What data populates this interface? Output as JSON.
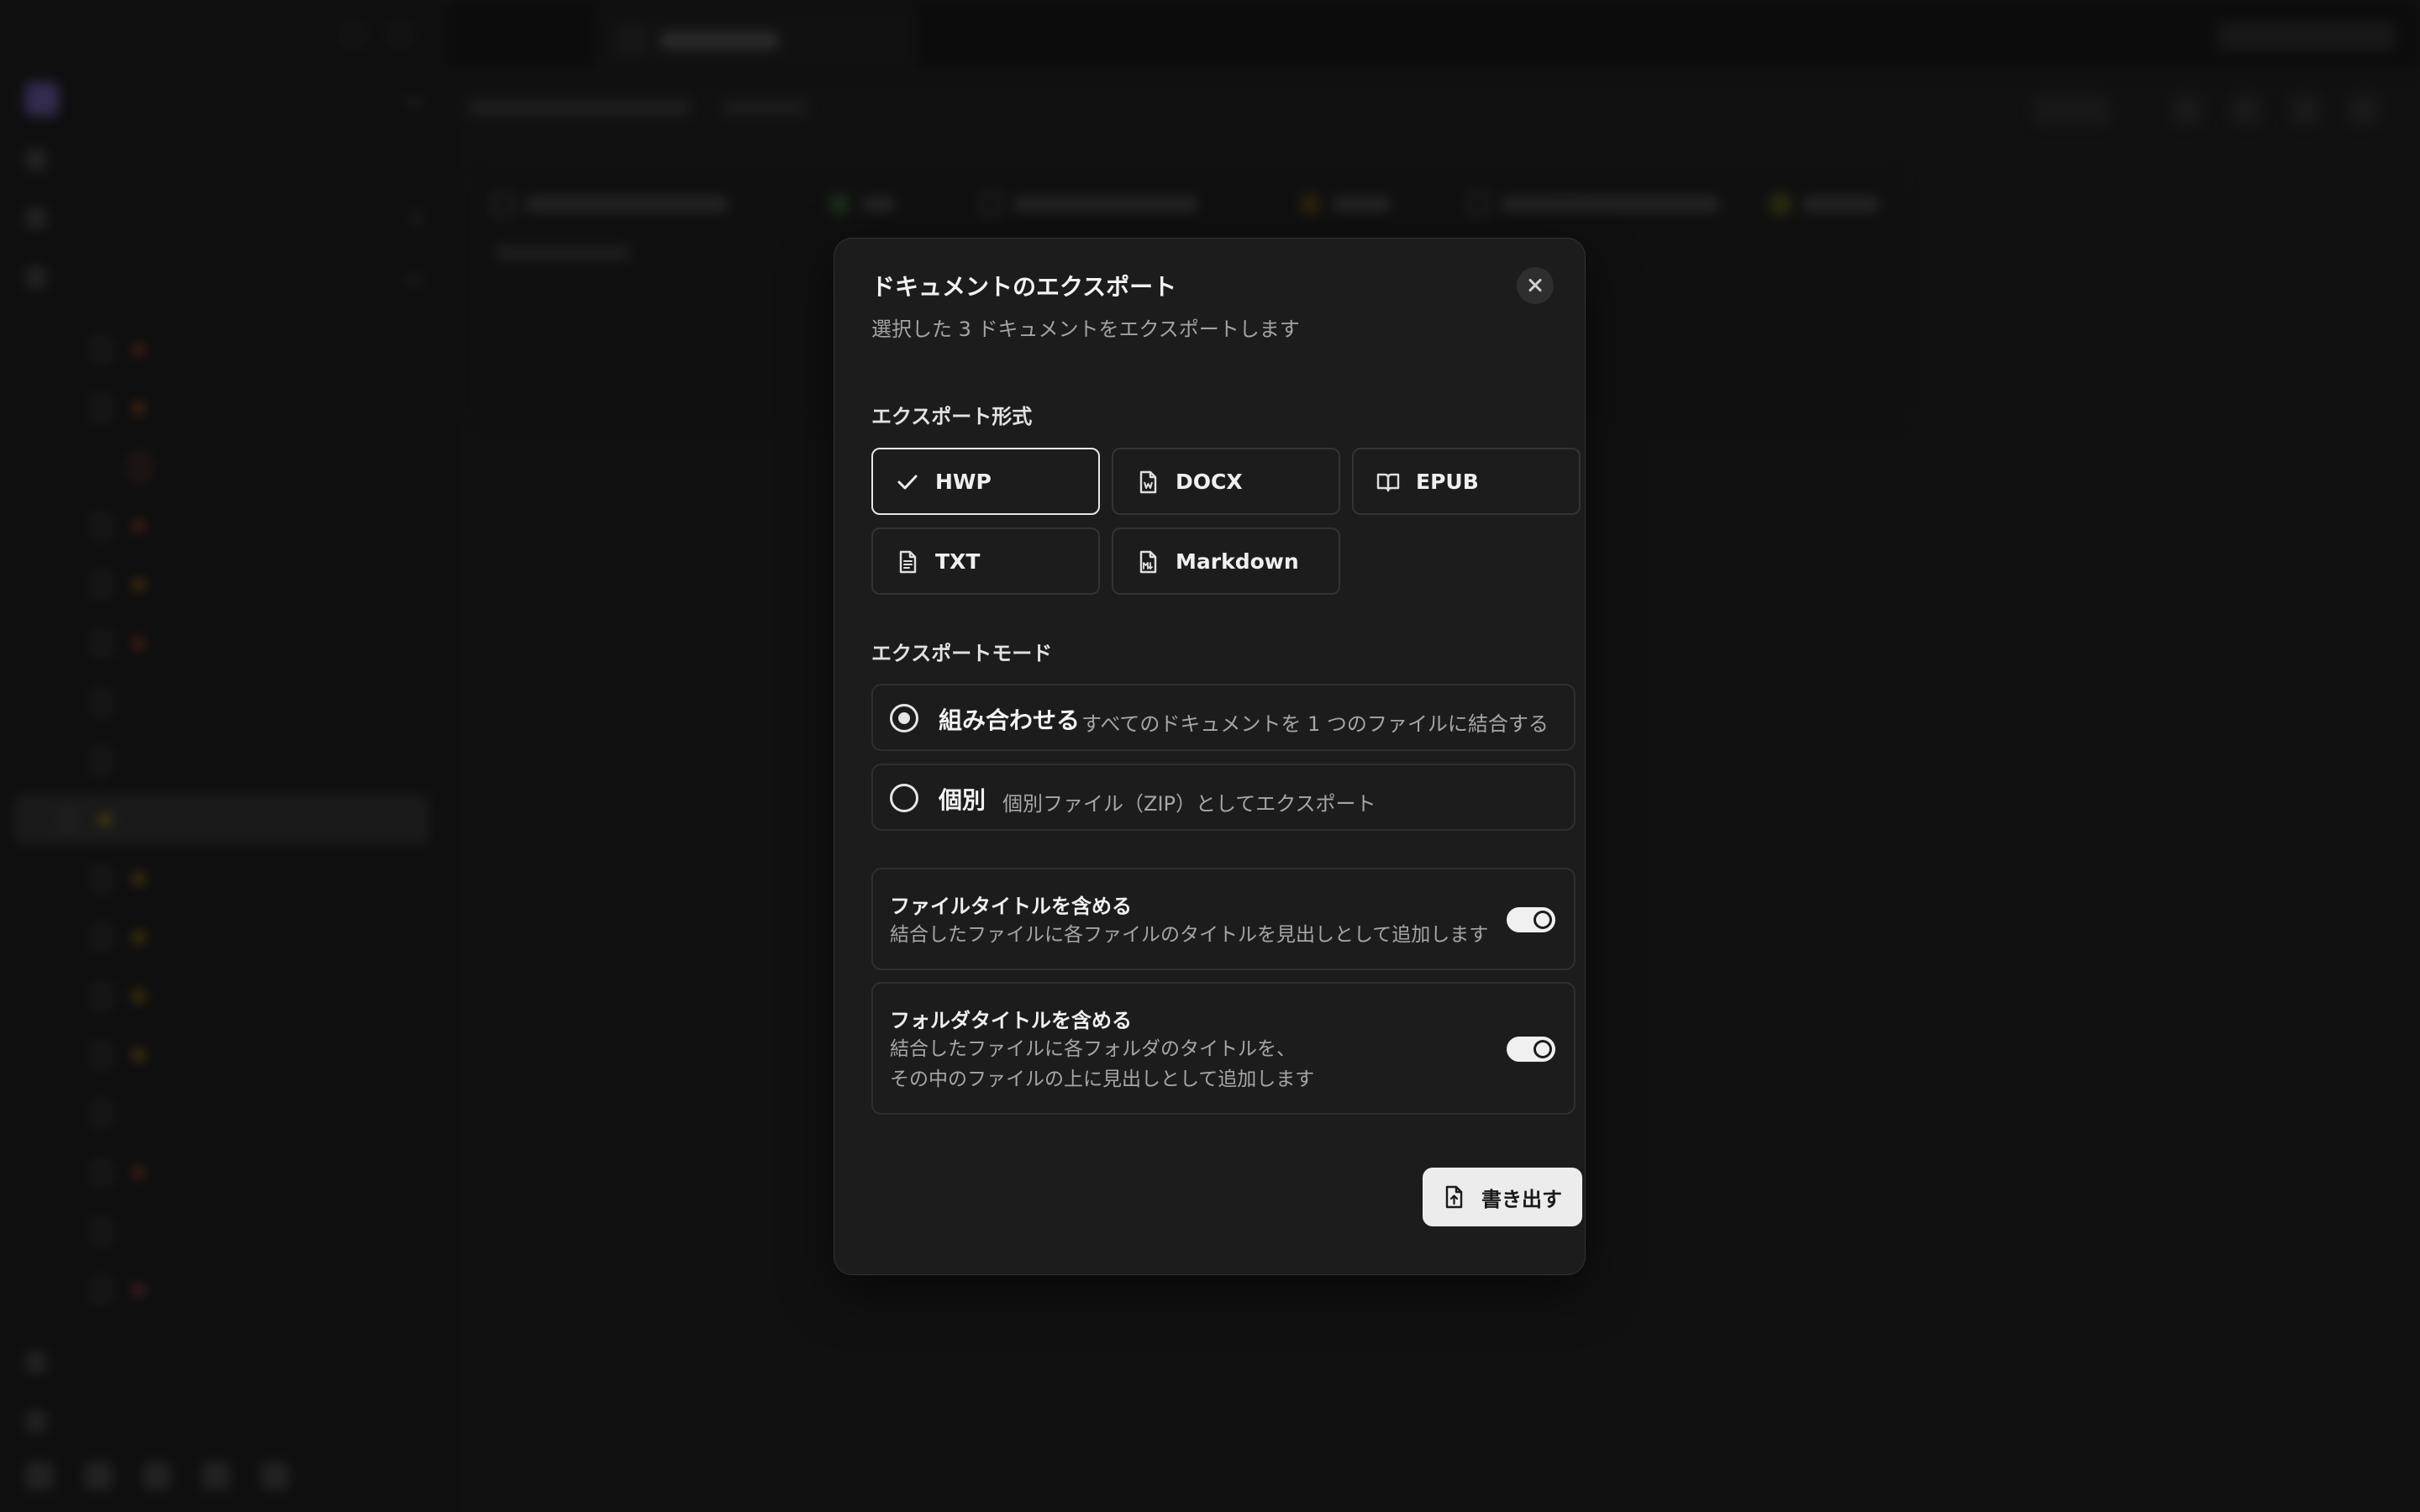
{
  "modal": {
    "title": "ドキュメントのエクスポート",
    "subtitle": "選択した 3 ドキュメントをエクスポートします",
    "format_section_label": "エクスポート形式",
    "formats": [
      {
        "label": "HWP",
        "icon": "check-icon",
        "selected": true
      },
      {
        "label": "DOCX",
        "icon": "word-file-icon",
        "selected": false
      },
      {
        "label": "EPUB",
        "icon": "book-open-icon",
        "selected": false
      },
      {
        "label": "TXT",
        "icon": "text-file-icon",
        "selected": false
      },
      {
        "label": "Markdown",
        "icon": "markdown-file-icon",
        "selected": false
      }
    ],
    "mode_section_label": "エクスポートモード",
    "modes": [
      {
        "name": "組み合わせる",
        "description": "すべてのドキュメントを 1 つのファイルに結合する",
        "selected": true
      },
      {
        "name": "個別",
        "description": "個別ファイル（ZIP）としてエクスポート",
        "selected": false
      }
    ],
    "options": [
      {
        "title": "ファイルタイトルを含める",
        "description_lines": [
          "結合したファイルに各ファイルのタイトルを見出しとして追加します"
        ],
        "enabled": true
      },
      {
        "title": "フォルダタイトルを含める",
        "description_lines": [
          "結合したファイルに各フォルダのタイトルを、",
          "その中のファイルの上に見出しとして追加します"
        ],
        "enabled": true
      }
    ],
    "export_button_label": "書き出す",
    "export_button_icon": "file-export-icon"
  },
  "colors": {
    "modal_bg": "#1c1c1c",
    "selected_border": "#e6e6e6",
    "button_bg": "#ececec"
  }
}
